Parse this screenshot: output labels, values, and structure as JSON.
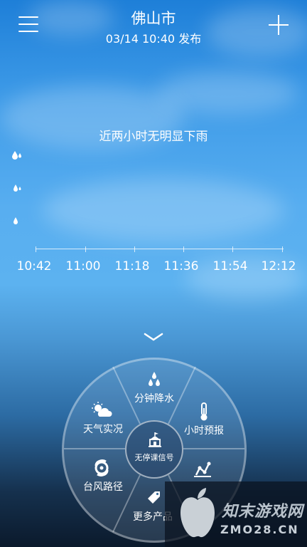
{
  "header": {
    "city": "佛山市",
    "published": "03/14  10:40 发布",
    "menu_icon": "hamburger-menu-icon",
    "add_icon": "plus-icon"
  },
  "precipitation": {
    "message": "近两小时无明显下雨",
    "time_labels": [
      "10:42",
      "11:00",
      "11:18",
      "11:36",
      "11:54",
      "12:12"
    ]
  },
  "wheel": {
    "top": {
      "label": "分钟降水",
      "icon": "raindrops-icon"
    },
    "upper_right": {
      "label": "小时预报",
      "icon": "thermometer-icon"
    },
    "upper_left": {
      "label": "天气实况",
      "icon": "sun-cloud-icon"
    },
    "lower_left": {
      "label": "台风路径",
      "icon": "typhoon-icon"
    },
    "lower_right": {
      "label": "",
      "icon": "trend-line-icon"
    },
    "bottom": {
      "label": "更多产品",
      "icon": "tag-icon"
    },
    "center": {
      "label": "无停课信号",
      "icon": "school-icon"
    }
  },
  "watermark": {
    "brand": "知末游戏网",
    "domain": "ZMO28.CN"
  },
  "colors": {
    "sky_top": "#1e7fd8",
    "sky_mid": "#5cb2f0",
    "bottom": "#0b1a2c"
  }
}
